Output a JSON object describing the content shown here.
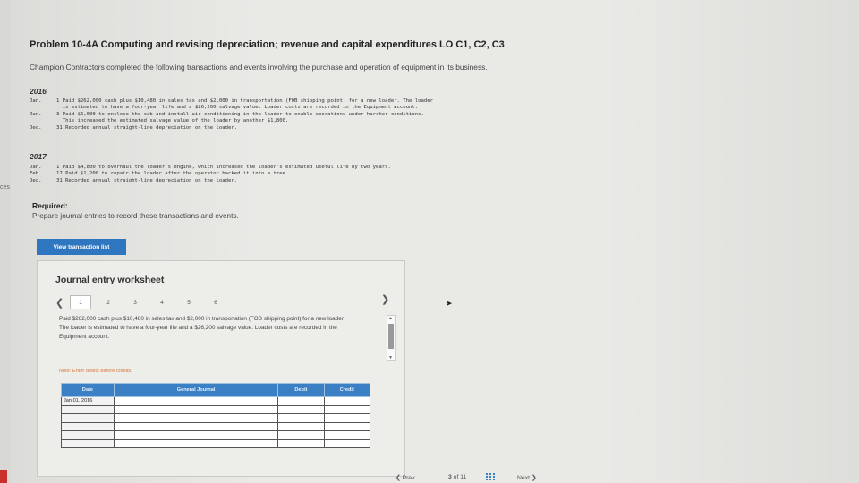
{
  "left_rail": {
    "label": "ces"
  },
  "problem": {
    "title": "Problem 10-4A Computing and revising depreciation; revenue and capital expenditures LO C1, C2, C3",
    "intro": "Champion Contractors completed the following transactions and events involving the purchase and operation of equipment in its business."
  },
  "transactions": {
    "year1": "2016",
    "year1_rows": [
      {
        "date": "Jan.",
        "text": "1 Paid $262,000 cash plus $10,480 in sales tax and $2,000 in transportation (FOB shipping point) for a new loader. The loader"
      },
      {
        "date": "",
        "text": "  is estimated to have a four-year life and a $26,200 salvage value. Loader costs are recorded in the Equipment account."
      },
      {
        "date": "Jan.",
        "text": "3 Paid $6,000 to enclose the cab and install air conditioning in the loader to enable operations under harsher conditions."
      },
      {
        "date": "",
        "text": "  This increased the estimated salvage value of the loader by another $1,800."
      },
      {
        "date": "Dec.",
        "text": "31 Recorded annual straight-line depreciation on the loader."
      }
    ],
    "year2": "2017",
    "year2_rows": [
      {
        "date": "Jan.",
        "text": "1 Paid $4,800 to overhaul the loader's engine, which increased the loader's estimated useful life by two years."
      },
      {
        "date": "Feb.",
        "text": "17 Paid $1,200 to repair the loader after the operator backed it into a tree."
      },
      {
        "date": "Dec.",
        "text": "31 Recorded annual straight-line depreciation on the loader."
      }
    ]
  },
  "required": {
    "heading": "Required:",
    "text": "Prepare journal entries to record these transactions and events."
  },
  "view_button": "View transaction list",
  "worksheet": {
    "title": "Journal entry worksheet",
    "pages": [
      "1",
      "2",
      "3",
      "4",
      "5",
      "6"
    ],
    "prev_icon": "chevron-left-icon",
    "next_icon": "chevron-right-icon",
    "description": "Paid $262,000 cash plus $10,480 in sales tax and $2,000 in transportation (FOB shipping point) for a new loader. The loader is estimated to have a four-year life and a $26,200 salvage value. Loader costs are recorded in the Equipment account.",
    "note": "Note: Enter debits before credits.",
    "columns": {
      "date": "Date",
      "account": "General Journal",
      "debit": "Debit",
      "credit": "Credit"
    },
    "first_date": "Jan 01, 2016"
  },
  "footer": {
    "prev": "Prev",
    "page_current": "3",
    "page_of": "of 11",
    "next": "Next",
    "grid_icon": "grid-icon"
  }
}
